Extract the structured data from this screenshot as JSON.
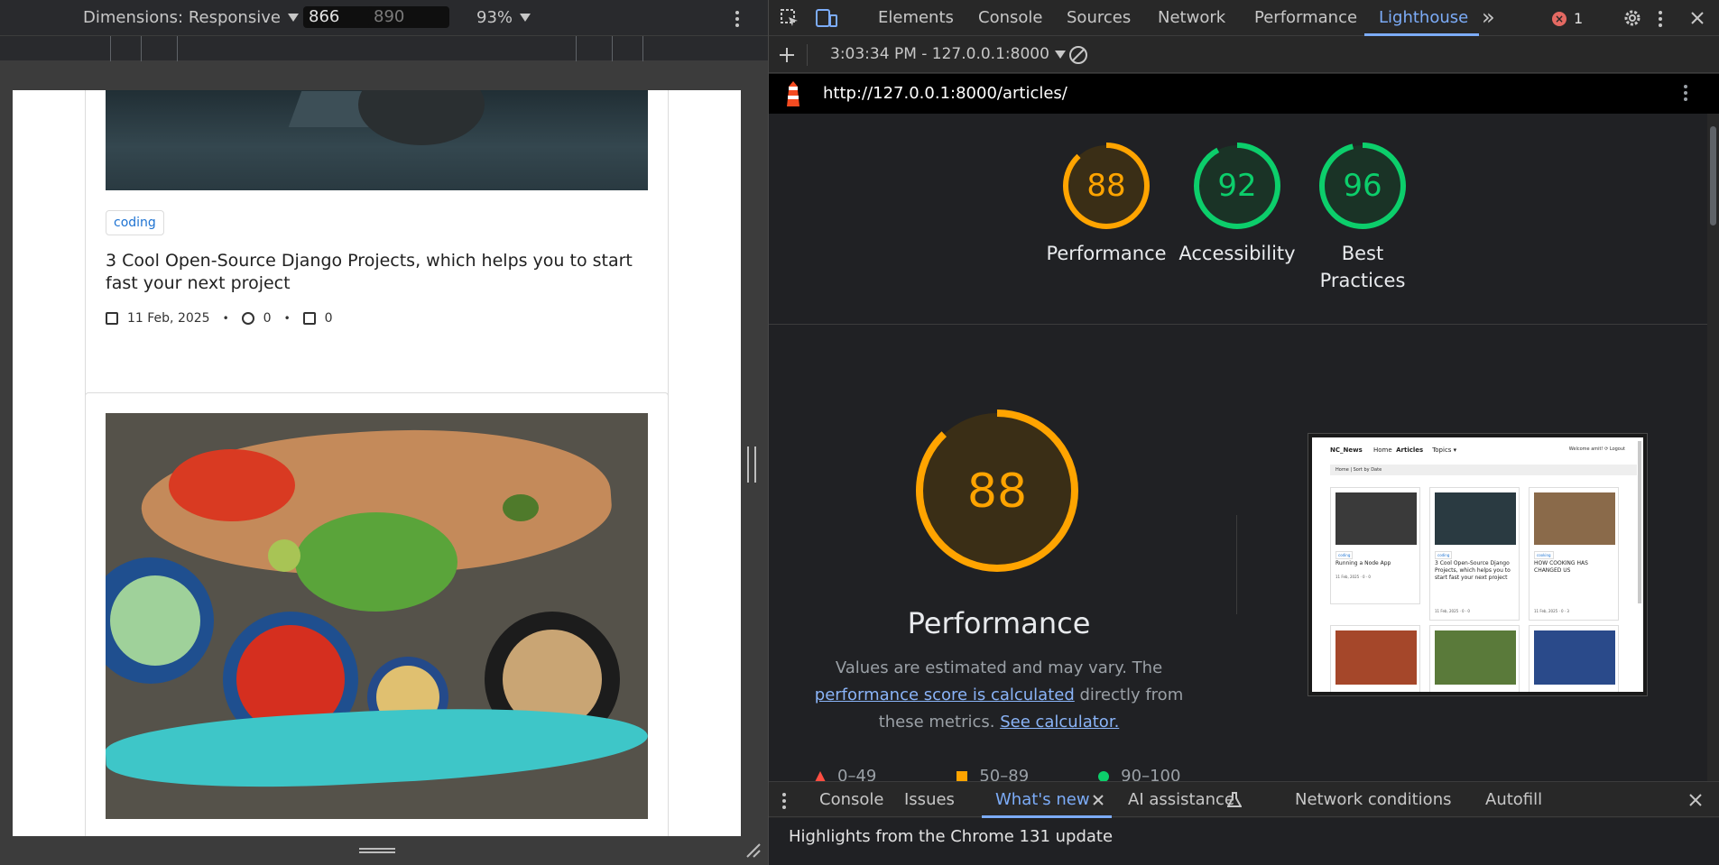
{
  "device_toolbar": {
    "dimensions_label": "Dimensions: Responsive",
    "width": "866",
    "height": "890",
    "times": "×",
    "zoom": "93%"
  },
  "page": {
    "card1": {
      "tag": "coding",
      "title": "3 Cool Open-Source Django Projects, which helps you to start fast your next project",
      "date": "11 Feb, 2025",
      "comments": "0",
      "likes": "0"
    }
  },
  "devtools": {
    "tabs": [
      "Elements",
      "Console",
      "Sources",
      "Network",
      "Performance",
      "Lighthouse"
    ],
    "active_tab": "Lighthouse",
    "more_tabs": "»",
    "error_count": "1",
    "report_selector": "3:03:34 PM - 127.0.0.1:8000",
    "url": "http://127.0.0.1:8000/articles/",
    "scores": [
      {
        "label": "Performance",
        "value": "88",
        "color": "#ffa400"
      },
      {
        "label": "Accessibility",
        "value": "92",
        "color": "#0cce6b"
      },
      {
        "label": "Best Practices",
        "value": "96",
        "color": "#0cce6b"
      }
    ],
    "performance": {
      "score": "88",
      "title": "Performance",
      "desc_pre": "Values are estimated and may vary. The ",
      "desc_link1": "performance score is calculated",
      "desc_mid": " directly from these metrics. ",
      "desc_link2": "See calculator.",
      "legend": [
        "0–49",
        "50–89",
        "90–100"
      ]
    },
    "thumbnail": {
      "brand": "NC_News",
      "nav": [
        "Home",
        "Articles",
        "Topics ▾"
      ],
      "user": "Welcome amit!  ⟳ Logout",
      "breadcrumb": "Home | Sort by  Date",
      "cards": [
        {
          "tag": "coding",
          "title": "Running a Node App",
          "meta": "11 Feb, 2025 · 0 · 0"
        },
        {
          "tag": "coding",
          "title": "3 Cool Open-Source Django Projects, which helps you to start fast your next project",
          "meta": "11 Feb, 2025 · 0 · 0"
        },
        {
          "tag": "cooking",
          "title": "HOW COOKING HAS CHANGED US",
          "meta": "11 Feb, 2025 · 0 · 3"
        }
      ]
    },
    "drawer": {
      "tabs": [
        "Console",
        "Issues",
        "What's new",
        "AI assistance",
        "Network conditions",
        "Autofill"
      ],
      "active_tab": "What's new",
      "content": "Highlights from the Chrome 131 update"
    }
  },
  "colors": {
    "accent": "#7cacf8",
    "average": "#ffa400",
    "pass": "#0cce6b",
    "fail": "#ff4e42"
  }
}
